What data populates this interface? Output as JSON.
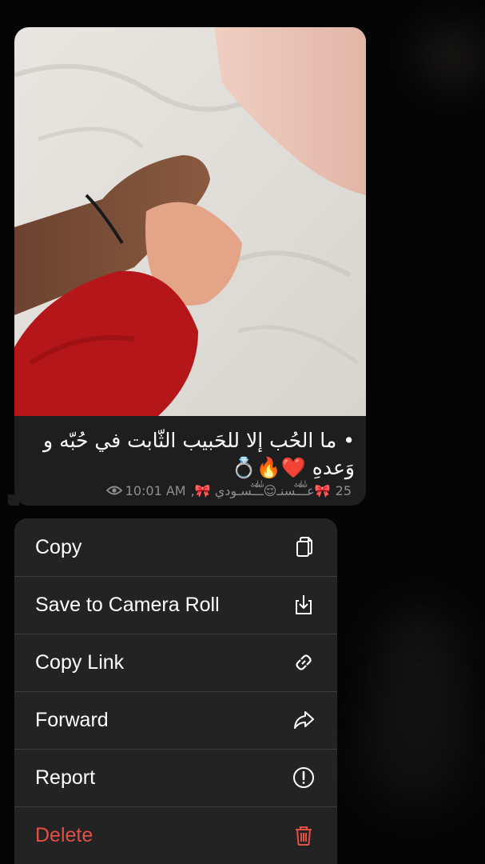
{
  "message": {
    "caption": "• ما الحُب إلا للحَبيب الثّابت في حُبّه و وَعدهِ ❤️🔥💍",
    "reactions_count": "25",
    "signature": "🎀عـّٰ̐ـّٰ̐ـسنـ😌ـّٰ̐ـّٰ̐ـسـودي 🎀,",
    "time": "10:01 AM"
  },
  "menu": {
    "items": [
      {
        "label": "Copy",
        "icon": "copy-icon"
      },
      {
        "label": "Save to Camera Roll",
        "icon": "download-icon"
      },
      {
        "label": "Copy Link",
        "icon": "link-icon"
      },
      {
        "label": "Forward",
        "icon": "forward-icon"
      },
      {
        "label": "Report",
        "icon": "report-icon"
      },
      {
        "label": "Delete",
        "icon": "trash-icon"
      }
    ]
  },
  "colors": {
    "background": "#050505",
    "bubble": "#1e1e1e",
    "menu": "#232323",
    "danger": "#e34f45",
    "meta": "#8e8e93"
  }
}
